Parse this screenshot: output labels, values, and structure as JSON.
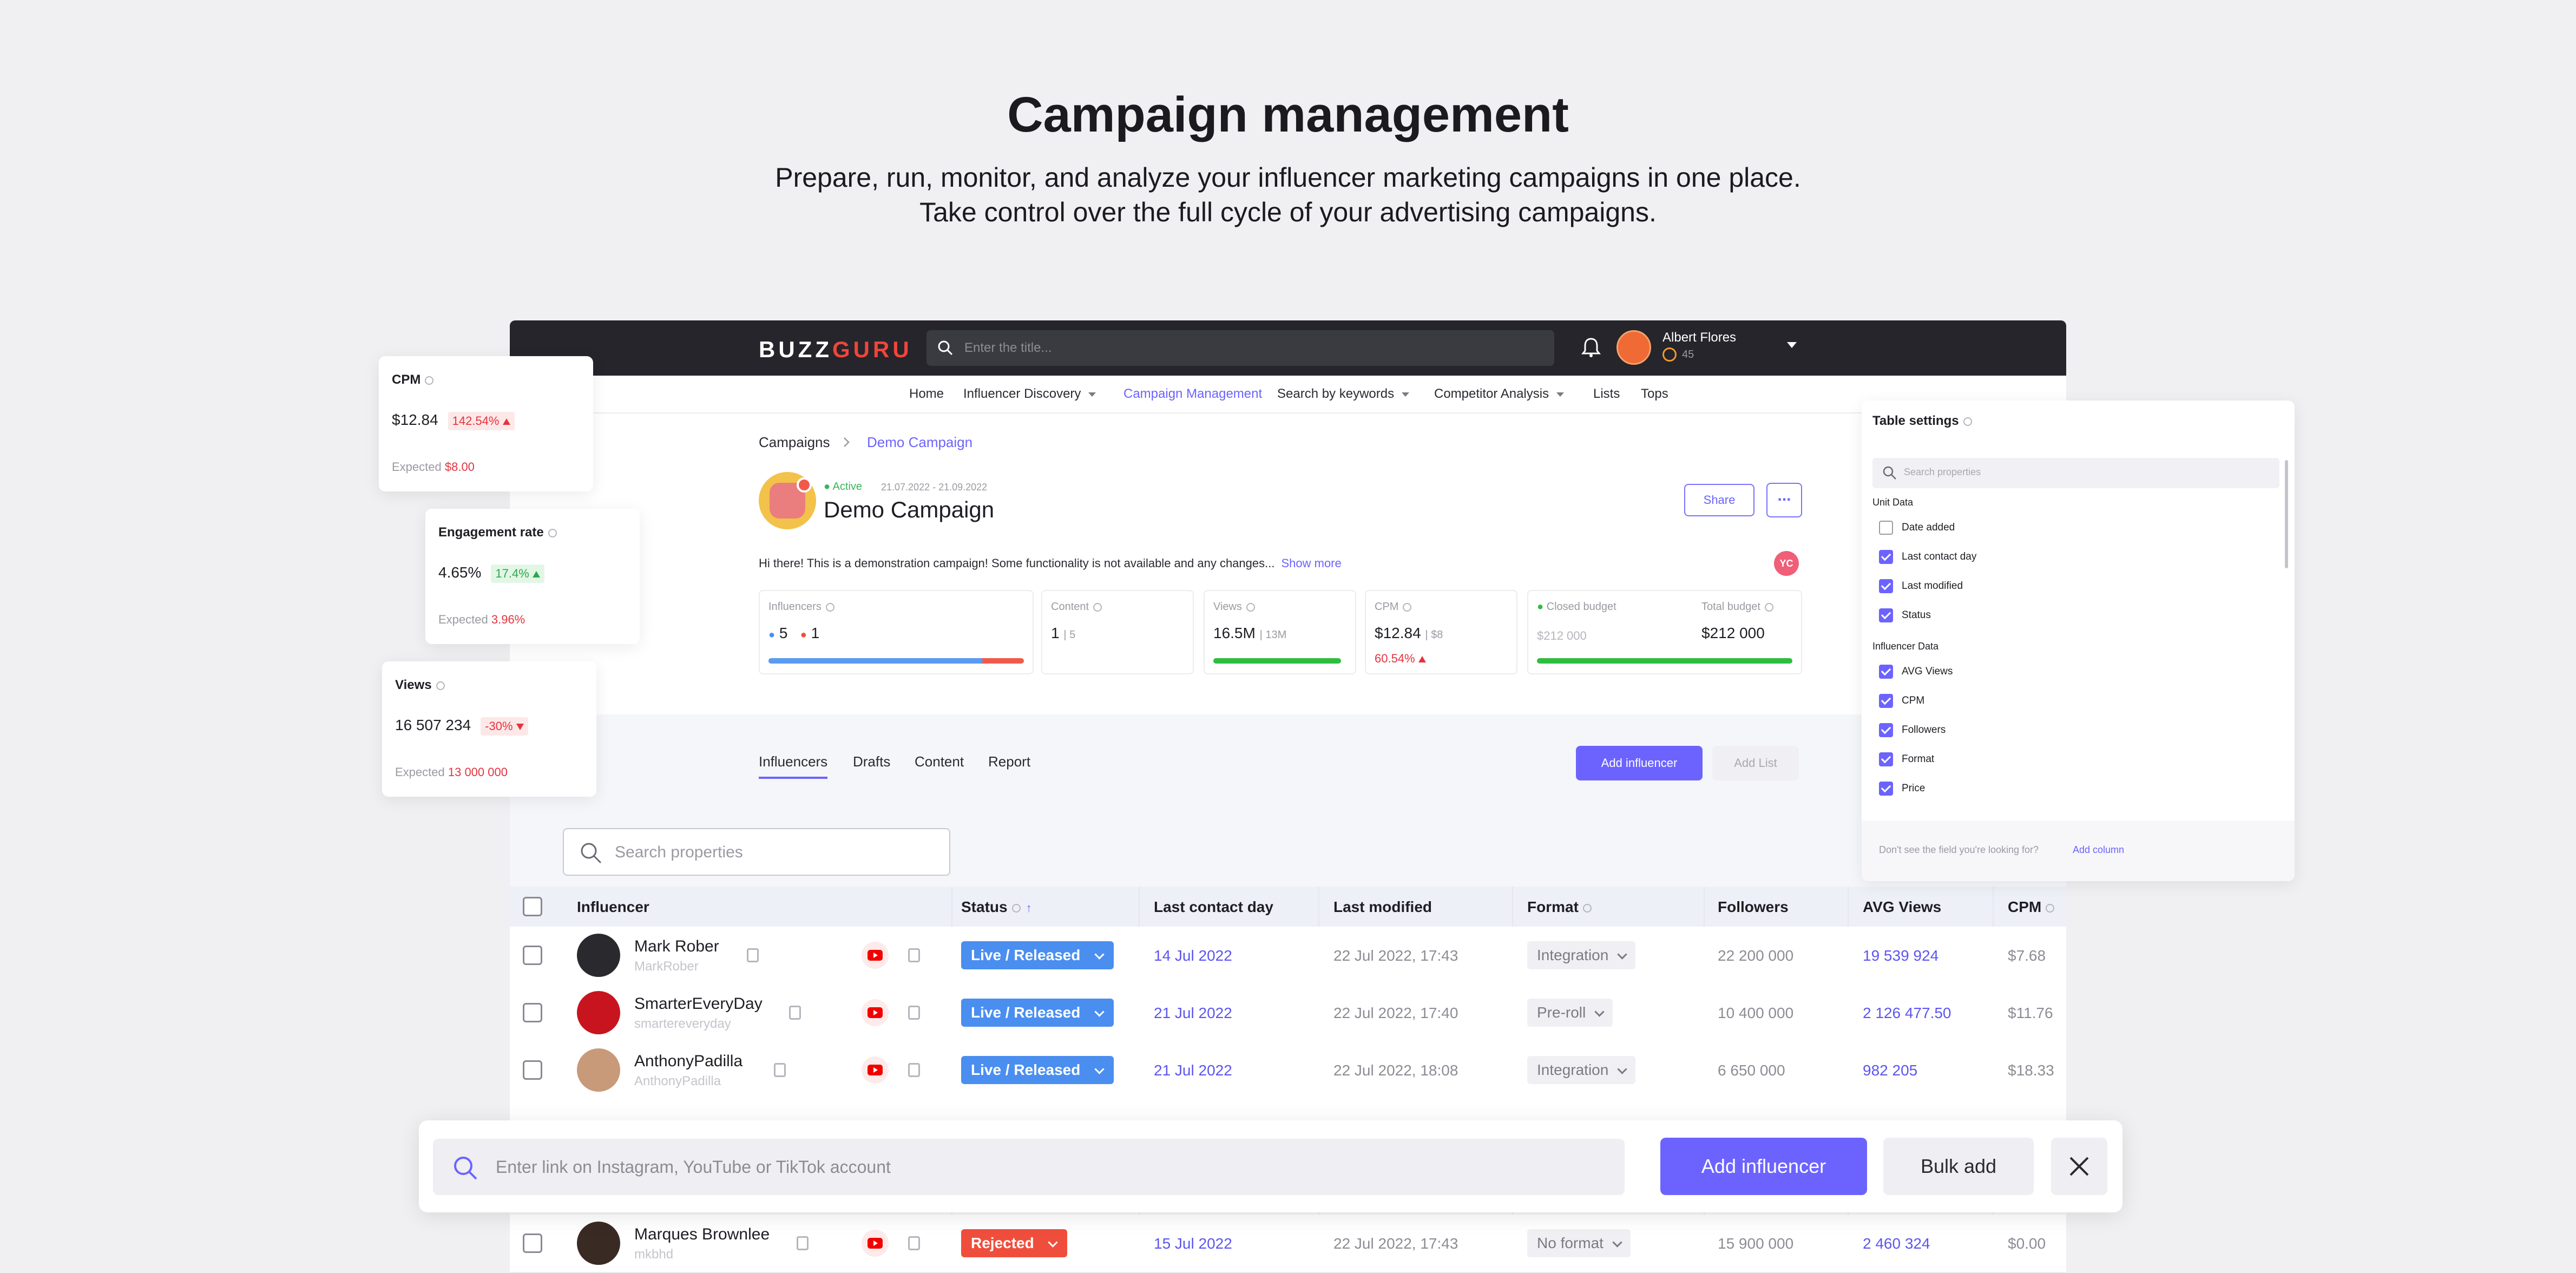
{
  "hero": {
    "title": "Campaign management",
    "subtitle_line1": "Prepare, run, monitor, and analyze your influencer marketing campaigns in one place.",
    "subtitle_line2": "Take control over the full cycle of your advertising campaigns."
  },
  "topbar": {
    "logo_a": "BUZZ",
    "logo_b": "GURU",
    "search_placeholder": "Enter the title...",
    "user_name": "Albert Flores",
    "user_points": "45"
  },
  "nav": [
    "Home",
    "Influencer Discovery",
    "Campaign Management",
    "Search by keywords",
    "Competitor Analysis",
    "Lists",
    "Tops"
  ],
  "breadcrumb": {
    "root": "Campaigns",
    "current": "Demo Campaign"
  },
  "campaign": {
    "status": "Active",
    "dates": "21.07.2022 - 21.09.2022",
    "title": "Demo Campaign",
    "share_label": "Share",
    "more_label": "...",
    "description": "Hi there! This is a demonstration campaign! Some functionality is not available and any changes...",
    "show_more": "Show more",
    "owner_initials": "YC"
  },
  "stats": {
    "influencers_label": "Influencers",
    "influencers_blue": "5",
    "influencers_red": "1",
    "content_label": "Content",
    "content_value": "1",
    "content_sub": "5",
    "views_label": "Views",
    "views_value": "16.5M",
    "views_sub": "13M",
    "cpm_label": "CPM",
    "cpm_value": "$12.84",
    "cpm_sub": "$8",
    "cpm_change": "60.54%",
    "closed_budget_label": "Closed budget",
    "closed_budget_value": "$212 000",
    "total_budget_label": "Total budget",
    "total_budget_value": "$212 000",
    "influencers_progress": 0.84,
    "views_progress": 1.0,
    "budget_progress": 1.0
  },
  "tabs": [
    "Influencers",
    "Drafts",
    "Content",
    "Report"
  ],
  "actions": {
    "add_influencer": "Add influencer",
    "add_list": "Add List"
  },
  "table": {
    "search_placeholder": "Search properties",
    "columns": [
      "Influencer",
      "Status",
      "Last contact day",
      "Last modified",
      "Format",
      "Followers",
      "AVG Views",
      "CPM"
    ],
    "rows": [
      {
        "name": "Mark Rober",
        "handle": "MarkRober",
        "status": "Live / Released",
        "last_contact": "14 Jul 2022",
        "last_modified": "22 Jul 2022, 17:43",
        "format": "Integration",
        "followers": "22 200 000",
        "avg_views": "19 539 924",
        "cpm": "$7.68"
      },
      {
        "name": "SmarterEveryDay",
        "handle": "smartereveryday",
        "status": "Live / Released",
        "last_contact": "21 Jul 2022",
        "last_modified": "22 Jul 2022, 17:40",
        "format": "Pre-roll",
        "followers": "10 400 000",
        "avg_views": "2 126 477.50",
        "cpm": "$11.76"
      },
      {
        "name": "AnthonyPadilla",
        "handle": "AnthonyPadilla",
        "status": "Live / Released",
        "last_contact": "21 Jul 2022",
        "last_modified": "22 Jul 2022, 18:08",
        "format": "Integration",
        "followers": "6 650 000",
        "avg_views": "982 205",
        "cpm": "$18.33"
      },
      {
        "name": "Marques Brownlee",
        "handle": "mkbhd",
        "status": "Rejected",
        "last_contact": "15 Jul 2022",
        "last_modified": "22 Jul 2022, 17:43",
        "format": "No format",
        "followers": "15 900 000",
        "avg_views": "2 460 324",
        "cpm": "$0.00"
      }
    ]
  },
  "float_cards": {
    "cpm": {
      "title": "CPM",
      "value": "$12.84",
      "change": "142.54%",
      "expected_label": "Expected",
      "expected_value": "$8.00"
    },
    "engagement": {
      "title": "Engagement rate",
      "value": "4.65%",
      "change": "17.4%",
      "expected_label": "Expected",
      "expected_value": "3.96%"
    },
    "views": {
      "title": "Views",
      "value": "16 507 234",
      "change": "-30%",
      "expected_label": "Expected",
      "expected_value": "13 000 000"
    }
  },
  "table_settings": {
    "title": "Table settings",
    "search_placeholder": "Search properties",
    "unit_section": "Unit Data",
    "unit_items": [
      {
        "label": "Date added",
        "checked": false
      },
      {
        "label": "Last contact day",
        "checked": true
      },
      {
        "label": "Last modified",
        "checked": true
      },
      {
        "label": "Status",
        "checked": true
      }
    ],
    "influencer_section": "Influencer Data",
    "influencer_items": [
      {
        "label": "AVG Views",
        "checked": true
      },
      {
        "label": "CPM",
        "checked": true
      },
      {
        "label": "Followers",
        "checked": true
      },
      {
        "label": "Format",
        "checked": true
      },
      {
        "label": "Price",
        "checked": true
      }
    ],
    "footer_question": "Don't see the field you're looking for?",
    "footer_action": "Add column"
  },
  "bottom_bar": {
    "placeholder": "Enter link on Instagram, YouTube or TikTok account",
    "add_label": "Add influencer",
    "bulk_label": "Bulk add"
  },
  "colors": {
    "accent": "#6c63ff",
    "live": "#4a8ef0",
    "rejected": "#f04e3c",
    "topbar": "#25252b"
  }
}
